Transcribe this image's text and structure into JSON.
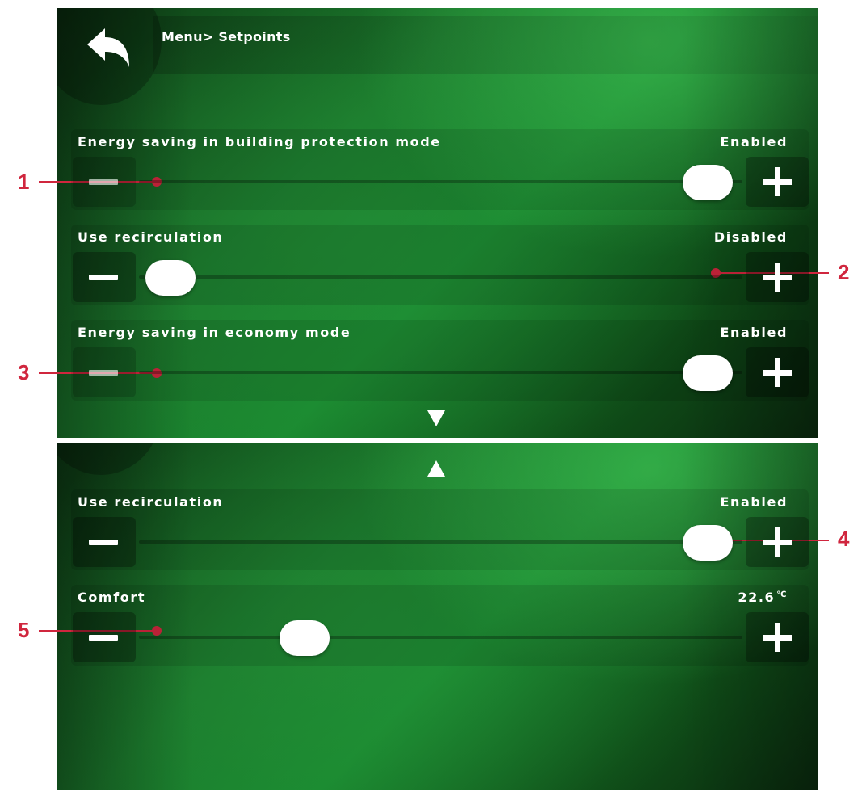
{
  "breadcrumb": "Menu> Setpoints",
  "icons": {
    "back": "back-arrow-icon",
    "scroll_down": "triangle-down-icon",
    "scroll_up": "triangle-up-icon",
    "minus": "minus-icon",
    "plus": "plus-icon"
  },
  "top_rows": [
    {
      "label": "Energy saving in building protection mode",
      "value": "Enabled",
      "level": 1
    },
    {
      "label": "Use recirculation",
      "value": "Disabled",
      "level": 0
    },
    {
      "label": "Energy saving in economy mode",
      "value": "Enabled",
      "level": 1
    }
  ],
  "bottom_rows": [
    {
      "label": "Use recirculation",
      "value": "Enabled",
      "level": 1
    },
    {
      "label": "Comfort",
      "value": "22.6",
      "unit": "℃"
    }
  ],
  "callouts": [
    "1",
    "2",
    "3",
    "4",
    "5"
  ],
  "colors": {
    "accent": "#1b8a30",
    "callout": "#d0263e",
    "text": "#ffffff"
  }
}
